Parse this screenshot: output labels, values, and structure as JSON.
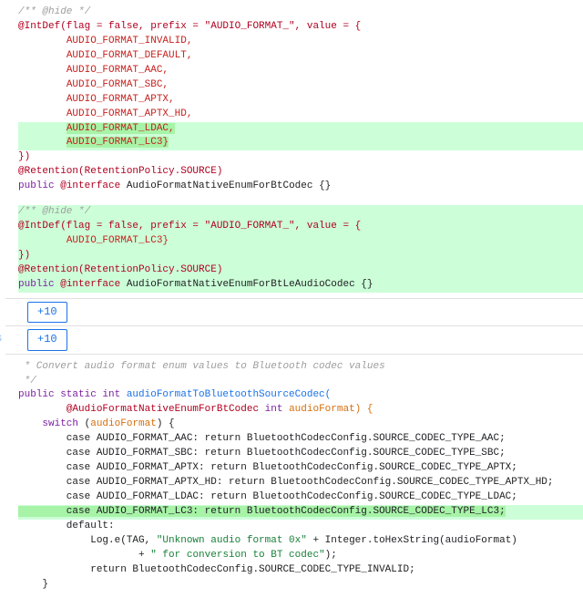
{
  "expand_label_1": "+10",
  "expand_label_2": "+10",
  "block1": {
    "c_hide": "/** @hide */",
    "intdef": "@IntDef(flag = false, prefix = \"AUDIO_FORMAT_\", value = {",
    "e1": "AUDIO_FORMAT_INVALID,",
    "e2": "AUDIO_FORMAT_DEFAULT,",
    "e3": "AUDIO_FORMAT_AAC,",
    "e4": "AUDIO_FORMAT_SBC,",
    "e5": "AUDIO_FORMAT_APTX,",
    "e6": "AUDIO_FORMAT_APTX_HD,",
    "e7": "AUDIO_FORMAT_LDAC,",
    "e8": "AUDIO_FORMAT_LC3}",
    "close": "})",
    "retention": "@Retention(RetentionPolicy.SOURCE)",
    "decl_pub": "public ",
    "decl_ann": "@interface",
    "decl_name": " AudioFormatNativeEnumForBtCodec {}"
  },
  "block2": {
    "c_hide": "/** @hide */",
    "intdef": "@IntDef(flag = false, prefix = \"AUDIO_FORMAT_\", value = {",
    "e1": "AUDIO_FORMAT_LC3}",
    "close": "})",
    "retention": "@Retention(RetentionPolicy.SOURCE)",
    "decl_pub": "public ",
    "decl_ann": "@interface",
    "decl_name": " AudioFormatNativeEnumForBtLeAudioCodec {}"
  },
  "block3": {
    "c1": " * Convert audio format enum values to Bluetooth codec values",
    "c2": " */",
    "pub": "public static int",
    "fname": " audioFormatToBluetoothSourceCodec(",
    "param_ann": "@AudioFormatNativeEnumForBtCodec",
    "param_type": " int ",
    "param_name": "audioFormat) {",
    "switch_open": "switch (audioFormat) {",
    "case_aac": "        case AUDIO_FORMAT_AAC: return BluetoothCodecConfig.SOURCE_CODEC_TYPE_AAC;",
    "case_sbc": "        case AUDIO_FORMAT_SBC: return BluetoothCodecConfig.SOURCE_CODEC_TYPE_SBC;",
    "case_aptx": "        case AUDIO_FORMAT_APTX: return BluetoothCodecConfig.SOURCE_CODEC_TYPE_APTX;",
    "case_aptx_hd": "        case AUDIO_FORMAT_APTX_HD: return BluetoothCodecConfig.SOURCE_CODEC_TYPE_APTX_HD;",
    "case_ldac": "        case AUDIO_FORMAT_LDAC: return BluetoothCodecConfig.SOURCE_CODEC_TYPE_LDAC;",
    "case_lc3": "        case AUDIO_FORMAT_LC3: return BluetoothCodecConfig.SOURCE_CODEC_TYPE_LC3;",
    "default": "        default:",
    "log_a": "            Log.e(TAG, ",
    "log_s1": "\"Unknown audio format 0x\"",
    "log_b": " + Integer.toHexString(audioFormat)",
    "log_c": "                    + ",
    "log_s2": "\" for conversion to BT codec\"",
    "log_d": ");",
    "ret": "            return BluetoothCodecConfig.SOURCE_CODEC_TYPE_INVALID;",
    "brace": "    }"
  }
}
